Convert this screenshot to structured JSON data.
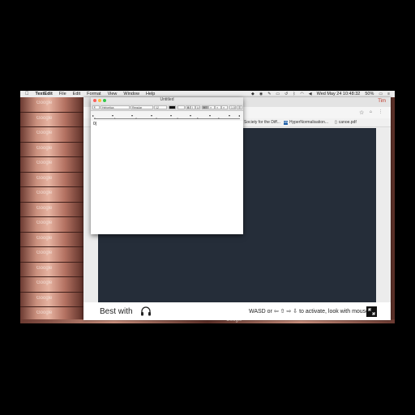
{
  "menubar": {
    "apple_icon": "apple-icon",
    "app": "TextEdit",
    "items": [
      "File",
      "Edit",
      "Format",
      "View",
      "Window",
      "Help"
    ],
    "battery": "50%",
    "datetime": "Wed May 24  10:48:32",
    "user": "≡"
  },
  "desktop": {
    "tile_label": "Google"
  },
  "browser": {
    "close_label": "Tim",
    "bookmarks": [
      {
        "label": "Society for the Diff..."
      },
      {
        "label": "HyperNormalisation..."
      },
      {
        "label": "canoe.pdf"
      }
    ],
    "bookmark_badge": "HN",
    "footer": {
      "best_with": "Best with",
      "instructions": "WASD or ⇦ ⇧ ⇨ ⇩ to activate, look with mouse"
    }
  },
  "textedit": {
    "title": "Untitled",
    "font_family": "Helvetica",
    "font_style": "Regular",
    "font_size": "12",
    "spacing": "1.0",
    "ruler_numbers": [
      "0",
      "1",
      "2",
      "3",
      "4",
      "5",
      "6"
    ],
    "body_text": "0|"
  },
  "colors": {
    "game_bg": "#252d39",
    "desktop_tile": "#c98f7d"
  }
}
